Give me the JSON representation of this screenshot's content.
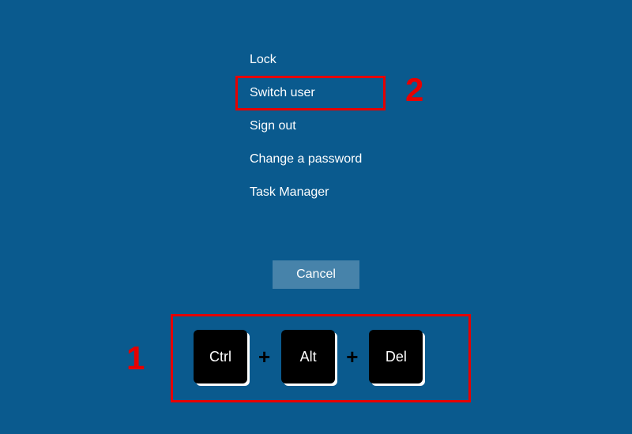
{
  "menu": {
    "items": [
      {
        "label": "Lock"
      },
      {
        "label": "Switch user"
      },
      {
        "label": "Sign out"
      },
      {
        "label": "Change a password"
      },
      {
        "label": "Task Manager"
      }
    ]
  },
  "cancel": {
    "label": "Cancel"
  },
  "annotations": {
    "num1": "1",
    "num2": "2"
  },
  "keys": {
    "k1": "Ctrl",
    "plus": "+",
    "k2": "Alt",
    "k3": "Del"
  }
}
